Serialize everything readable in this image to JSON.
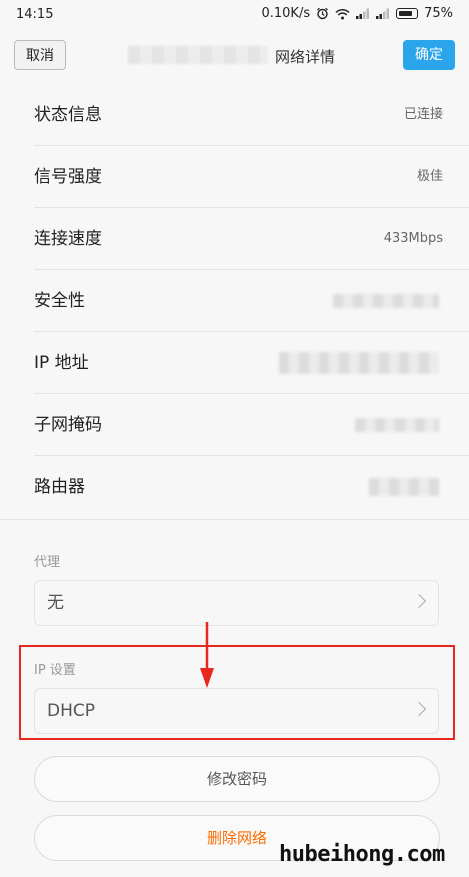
{
  "status_bar": {
    "time": "14:15",
    "network_speed": "0.10K/s",
    "battery": "75%",
    "icons": [
      "alarm-icon",
      "wifi-icon",
      "signal-icon",
      "signal-icon",
      "battery-icon"
    ]
  },
  "title_bar": {
    "cancel_label": "取消",
    "title": "网络详情",
    "confirm_label": "确定"
  },
  "details": [
    {
      "label": "状态信息",
      "value": "已连接"
    },
    {
      "label": "信号强度",
      "value": "极佳"
    },
    {
      "label": "连接速度",
      "value": "433Mbps"
    },
    {
      "label": "安全性",
      "value": ""
    },
    {
      "label": "IP 地址",
      "value": ""
    },
    {
      "label": "子网掩码",
      "value": ""
    },
    {
      "label": "路由器",
      "value": ""
    }
  ],
  "proxy": {
    "section_label": "代理",
    "value": "无"
  },
  "ip_settings": {
    "section_label": "IP 设置",
    "value": "DHCP"
  },
  "actions": {
    "modify_password": "修改密码",
    "delete_network": "删除网络"
  },
  "colors": {
    "accent": "#2aa5ec",
    "danger_text": "#ff6a00",
    "highlight_box": "#e8271f"
  },
  "watermark": "hubeihong.com"
}
